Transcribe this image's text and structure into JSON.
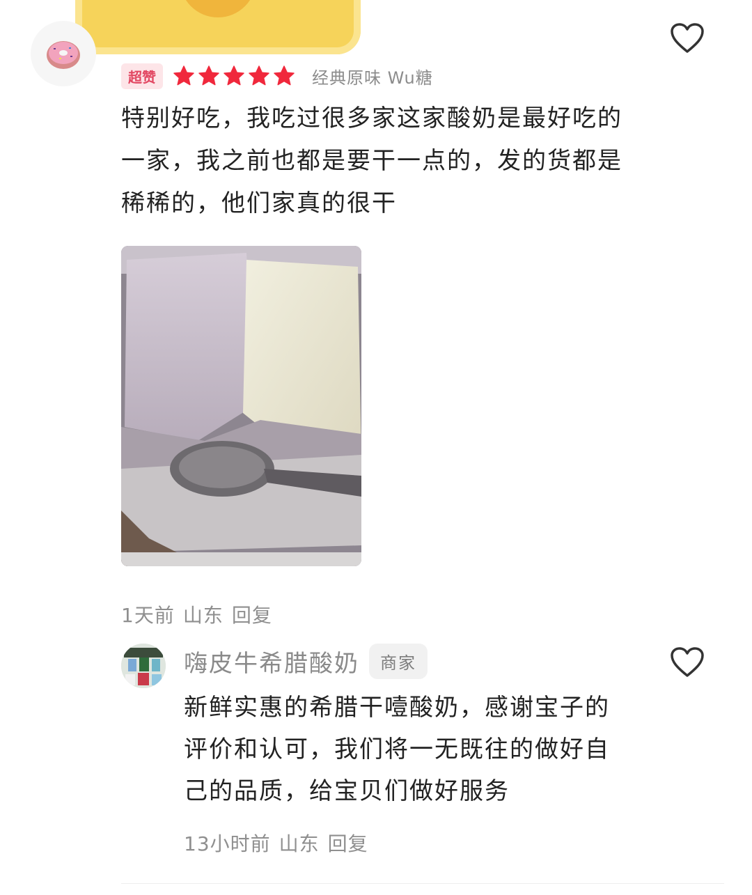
{
  "review": {
    "badge": "超赞",
    "rating": 5,
    "variant": "经典原味  Wu糖",
    "text": "特别好吃，我吃过很多家这家酸奶是最好吃的一家，我之前也都是要干一点的，发的货都是稀稀的，他们家真的很干",
    "meta": {
      "time": "1天前",
      "location": "山东",
      "reply": "回复"
    }
  },
  "merchant_reply": {
    "name": "嗨皮牛希腊酸奶",
    "badge": "商家",
    "text": "新鲜实惠的希腊干噎酸奶，感谢宝子的评价和认可，我们将一无既往的做好自己的品质，给宝贝们做好服务",
    "meta": {
      "time": "13小时前",
      "location": "山东",
      "reply": "回复"
    }
  },
  "colors": {
    "accent": "#e24762",
    "star": "#f0283c",
    "muted": "#8f8f8f"
  },
  "icons": {
    "like": "heart-outline-icon",
    "avatar": "donut-icon",
    "rating": "star-icon"
  }
}
